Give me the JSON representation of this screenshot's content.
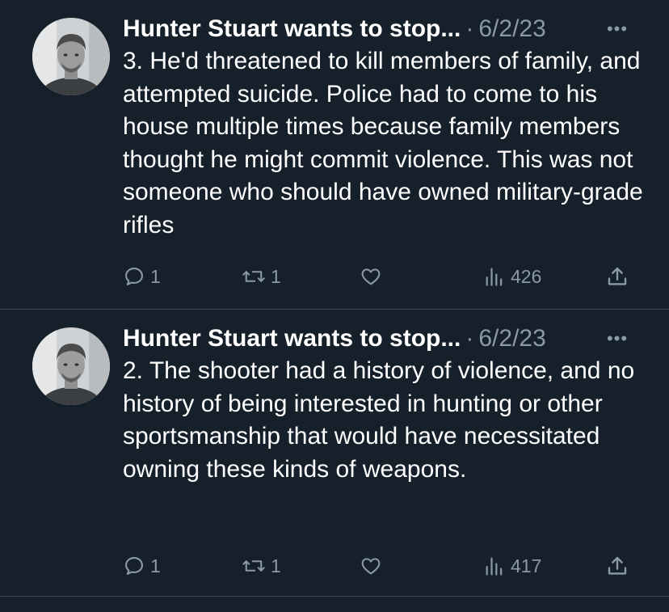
{
  "tweets": [
    {
      "author": "Hunter Stuart wants to stop...",
      "separator": "·",
      "date": "6/2/23",
      "more_label": "•••",
      "text": "3. He'd threatened to kill members of family, and attempted suicide. Police had to come to his house multiple times because family members thought he might commit violence. This was not someone who should have owned military-grade rifles",
      "replies": "1",
      "retweets": "1",
      "likes": "",
      "views": "426"
    },
    {
      "author": "Hunter Stuart wants to stop...",
      "separator": "·",
      "date": "6/2/23",
      "more_label": "•••",
      "text": "2. The shooter had a history of violence, and no history of being interested in hunting or other sportsmanship that would have necessitated owning these kinds of weapons.",
      "replies": "1",
      "retweets": "1",
      "likes": "",
      "views": "417"
    }
  ],
  "icons": {
    "reply": "reply-icon",
    "retweet": "retweet-icon",
    "like": "heart-icon",
    "views": "views-icon",
    "share": "share-icon"
  },
  "colors": {
    "background": "#15202b",
    "text": "#ffffff",
    "muted": "#8b98a5",
    "divider": "#38444d"
  }
}
